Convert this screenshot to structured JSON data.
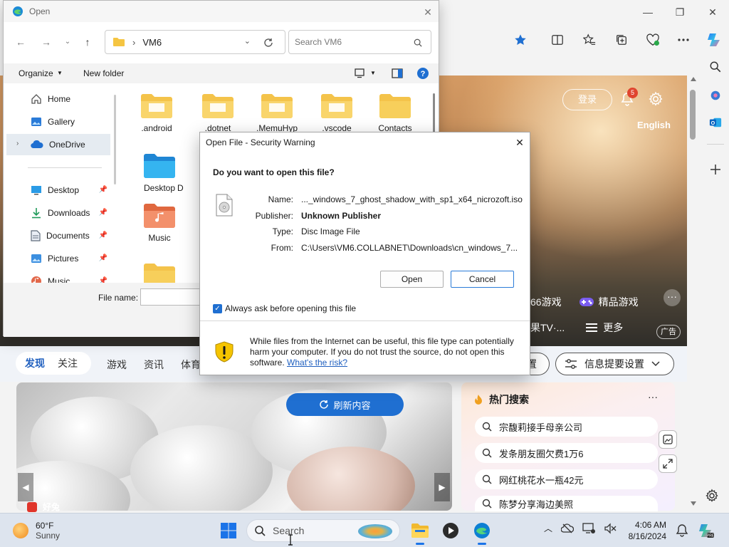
{
  "open_dialog": {
    "title": "Open",
    "address": {
      "location": "VM6"
    },
    "search_placeholder": "Search VM6",
    "commands": {
      "organize": "Organize",
      "new_folder": "New folder"
    },
    "nav_items": [
      {
        "label": "Home",
        "icon": "home-icon"
      },
      {
        "label": "Gallery",
        "icon": "gallery-icon"
      },
      {
        "label": "OneDrive",
        "icon": "cloud-icon"
      },
      {
        "label": "Desktop",
        "icon": "desktop-icon"
      },
      {
        "label": "Downloads",
        "icon": "download-icon"
      },
      {
        "label": "Documents",
        "icon": "documents-icon"
      },
      {
        "label": "Pictures",
        "icon": "pictures-icon"
      },
      {
        "label": "Music",
        "icon": "music-icon"
      }
    ],
    "files": [
      {
        "name": ".android"
      },
      {
        "name": ".dotnet"
      },
      {
        "name": ".MemuHyp"
      },
      {
        "name": ".vscode"
      },
      {
        "name": "Contacts"
      },
      {
        "name": "Desktop"
      },
      {
        "name": "D"
      },
      {
        "name": "Music"
      }
    ],
    "file_name_label": "File name:"
  },
  "security_warning": {
    "title": "Open File - Security Warning",
    "question": "Do you want to open this file?",
    "fields": [
      {
        "key": "Name:",
        "value": "..._windows_7_ghost_shadow_with_sp1_x64_nicrozoft.iso"
      },
      {
        "key": "Publisher:",
        "value": "Unknown Publisher"
      },
      {
        "key": "Type:",
        "value": "Disc Image File"
      },
      {
        "key": "From:",
        "value": "C:\\Users\\VM6.COLLABNET\\Downloads\\cn_windows_7..."
      }
    ],
    "open_label": "Open",
    "cancel_label": "Cancel",
    "checkbox_label": "Always ask before opening this file",
    "checkbox_checked": true,
    "info_text": "While files from the Internet can be useful, this file type can potentially harm your computer. If you do not trust the source, do not open this software.",
    "info_link": "What's the risk?"
  },
  "browser": {
    "hero": {
      "login": "登录",
      "notification_count": "5",
      "language": "English",
      "quick_links_row1": [
        "66游戏",
        "精品游戏"
      ],
      "quick_links_row2": [
        "果TV·...",
        "更多"
      ],
      "ad_label": "广告"
    },
    "feed": {
      "tabs_active": [
        "发现",
        "关注"
      ],
      "tabs": [
        "游戏",
        "资讯",
        "体育"
      ],
      "settings_partial": "置",
      "digest_settings": "信息提要设置",
      "refresh": "刷新内容",
      "article_source": "好兔",
      "hot_title": "热门搜索",
      "hot_more": "···",
      "hot_items": [
        "宗馥莉接手母亲公司",
        "发条朋友圈欠费1万6",
        "网红桃花水一瓶42元",
        "陈梦分享海边美照"
      ]
    },
    "colors": {
      "accent": "#1f6fd1",
      "hero_top": "#d49a63",
      "taskbar": "#dde4ee"
    }
  },
  "taskbar": {
    "temperature": "60°F",
    "condition": "Sunny",
    "search_placeholder": "Search",
    "time": "4:06 AM",
    "date": "8/16/2024"
  }
}
